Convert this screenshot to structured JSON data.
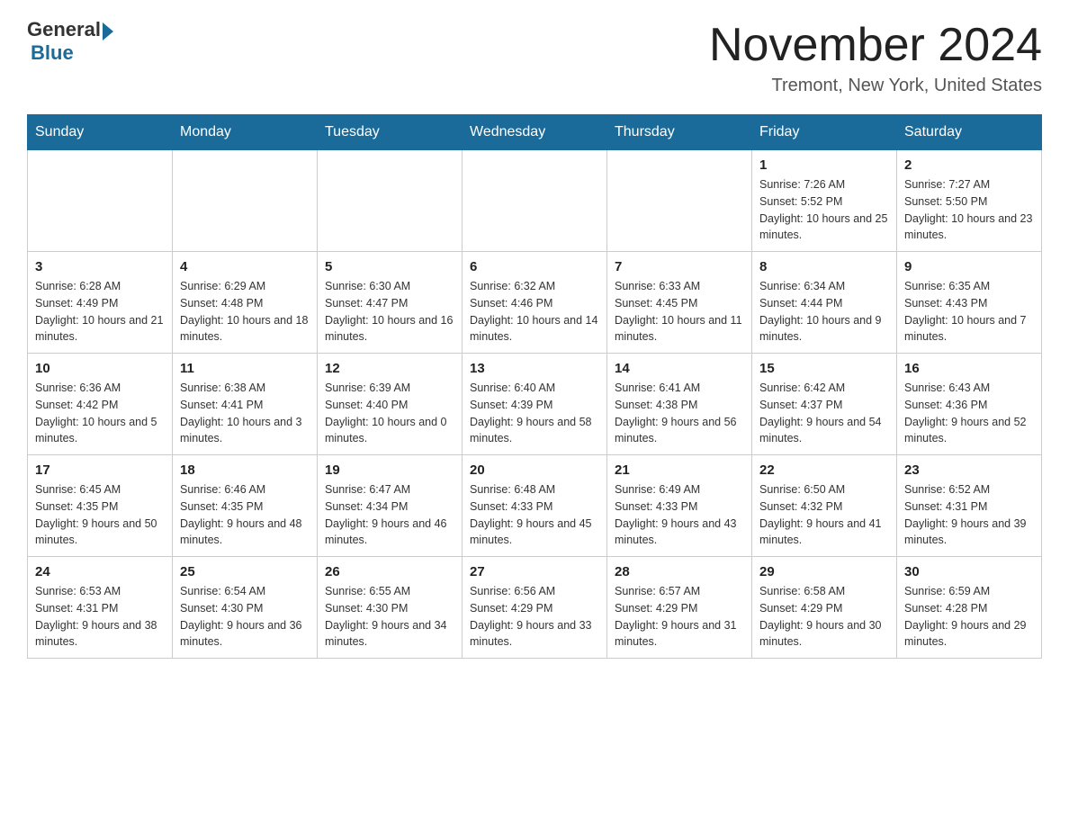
{
  "header": {
    "logo": {
      "general": "General",
      "blue": "Blue"
    },
    "title": "November 2024",
    "location": "Tremont, New York, United States"
  },
  "calendar": {
    "days_of_week": [
      "Sunday",
      "Monday",
      "Tuesday",
      "Wednesday",
      "Thursday",
      "Friday",
      "Saturday"
    ],
    "weeks": [
      [
        {
          "day": "",
          "info": ""
        },
        {
          "day": "",
          "info": ""
        },
        {
          "day": "",
          "info": ""
        },
        {
          "day": "",
          "info": ""
        },
        {
          "day": "",
          "info": ""
        },
        {
          "day": "1",
          "info": "Sunrise: 7:26 AM\nSunset: 5:52 PM\nDaylight: 10 hours and 25 minutes."
        },
        {
          "day": "2",
          "info": "Sunrise: 7:27 AM\nSunset: 5:50 PM\nDaylight: 10 hours and 23 minutes."
        }
      ],
      [
        {
          "day": "3",
          "info": "Sunrise: 6:28 AM\nSunset: 4:49 PM\nDaylight: 10 hours and 21 minutes."
        },
        {
          "day": "4",
          "info": "Sunrise: 6:29 AM\nSunset: 4:48 PM\nDaylight: 10 hours and 18 minutes."
        },
        {
          "day": "5",
          "info": "Sunrise: 6:30 AM\nSunset: 4:47 PM\nDaylight: 10 hours and 16 minutes."
        },
        {
          "day": "6",
          "info": "Sunrise: 6:32 AM\nSunset: 4:46 PM\nDaylight: 10 hours and 14 minutes."
        },
        {
          "day": "7",
          "info": "Sunrise: 6:33 AM\nSunset: 4:45 PM\nDaylight: 10 hours and 11 minutes."
        },
        {
          "day": "8",
          "info": "Sunrise: 6:34 AM\nSunset: 4:44 PM\nDaylight: 10 hours and 9 minutes."
        },
        {
          "day": "9",
          "info": "Sunrise: 6:35 AM\nSunset: 4:43 PM\nDaylight: 10 hours and 7 minutes."
        }
      ],
      [
        {
          "day": "10",
          "info": "Sunrise: 6:36 AM\nSunset: 4:42 PM\nDaylight: 10 hours and 5 minutes."
        },
        {
          "day": "11",
          "info": "Sunrise: 6:38 AM\nSunset: 4:41 PM\nDaylight: 10 hours and 3 minutes."
        },
        {
          "day": "12",
          "info": "Sunrise: 6:39 AM\nSunset: 4:40 PM\nDaylight: 10 hours and 0 minutes."
        },
        {
          "day": "13",
          "info": "Sunrise: 6:40 AM\nSunset: 4:39 PM\nDaylight: 9 hours and 58 minutes."
        },
        {
          "day": "14",
          "info": "Sunrise: 6:41 AM\nSunset: 4:38 PM\nDaylight: 9 hours and 56 minutes."
        },
        {
          "day": "15",
          "info": "Sunrise: 6:42 AM\nSunset: 4:37 PM\nDaylight: 9 hours and 54 minutes."
        },
        {
          "day": "16",
          "info": "Sunrise: 6:43 AM\nSunset: 4:36 PM\nDaylight: 9 hours and 52 minutes."
        }
      ],
      [
        {
          "day": "17",
          "info": "Sunrise: 6:45 AM\nSunset: 4:35 PM\nDaylight: 9 hours and 50 minutes."
        },
        {
          "day": "18",
          "info": "Sunrise: 6:46 AM\nSunset: 4:35 PM\nDaylight: 9 hours and 48 minutes."
        },
        {
          "day": "19",
          "info": "Sunrise: 6:47 AM\nSunset: 4:34 PM\nDaylight: 9 hours and 46 minutes."
        },
        {
          "day": "20",
          "info": "Sunrise: 6:48 AM\nSunset: 4:33 PM\nDaylight: 9 hours and 45 minutes."
        },
        {
          "day": "21",
          "info": "Sunrise: 6:49 AM\nSunset: 4:33 PM\nDaylight: 9 hours and 43 minutes."
        },
        {
          "day": "22",
          "info": "Sunrise: 6:50 AM\nSunset: 4:32 PM\nDaylight: 9 hours and 41 minutes."
        },
        {
          "day": "23",
          "info": "Sunrise: 6:52 AM\nSunset: 4:31 PM\nDaylight: 9 hours and 39 minutes."
        }
      ],
      [
        {
          "day": "24",
          "info": "Sunrise: 6:53 AM\nSunset: 4:31 PM\nDaylight: 9 hours and 38 minutes."
        },
        {
          "day": "25",
          "info": "Sunrise: 6:54 AM\nSunset: 4:30 PM\nDaylight: 9 hours and 36 minutes."
        },
        {
          "day": "26",
          "info": "Sunrise: 6:55 AM\nSunset: 4:30 PM\nDaylight: 9 hours and 34 minutes."
        },
        {
          "day": "27",
          "info": "Sunrise: 6:56 AM\nSunset: 4:29 PM\nDaylight: 9 hours and 33 minutes."
        },
        {
          "day": "28",
          "info": "Sunrise: 6:57 AM\nSunset: 4:29 PM\nDaylight: 9 hours and 31 minutes."
        },
        {
          "day": "29",
          "info": "Sunrise: 6:58 AM\nSunset: 4:29 PM\nDaylight: 9 hours and 30 minutes."
        },
        {
          "day": "30",
          "info": "Sunrise: 6:59 AM\nSunset: 4:28 PM\nDaylight: 9 hours and 29 minutes."
        }
      ]
    ]
  }
}
